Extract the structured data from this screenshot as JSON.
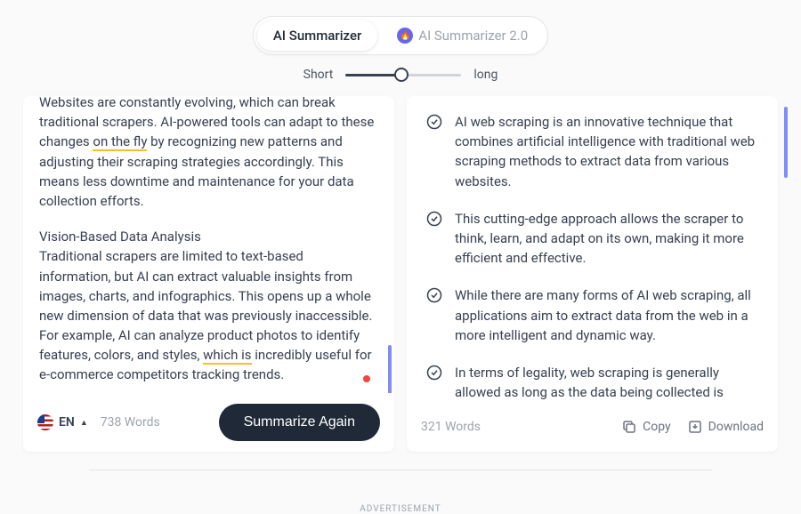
{
  "tabs": {
    "summarizer": "AI Summarizer",
    "summarizer2": "AI Summarizer 2.0"
  },
  "slider": {
    "short": "Short",
    "long": "long"
  },
  "input": {
    "para1_pre": "Websites are constantly evolving, which can break traditional scrapers. AI-powered tools can adapt to these changes ",
    "para1_underline": "on the fly",
    "para1_post": " by recognizing new patterns and adjusting their scraping strategies accordingly. This means less downtime and maintenance for your data collection efforts.",
    "subhead": "Vision-Based Data Analysis",
    "para2_pre": "Traditional scrapers are limited to text-based information, but AI can extract valuable insights from images, charts, and infographics. This opens up a whole new dimension of data that was previously inaccessible. For example, AI can analyze product photos to identify features, colors, and styles, ",
    "para2_underline": "which is",
    "para2_post": " incredibly useful for e-commerce competitors tracking trends."
  },
  "summary": [
    "AI web scraping is an innovative technique that combines artificial intelligence with traditional web scraping methods to extract data from various websites.",
    "This cutting-edge approach allows the scraper to think, learn, and adapt on its own, making it more efficient and effective.",
    "While there are many forms of AI web scraping, all applications aim to extract data from the web in a more intelligent and dynamic way.",
    "In terms of legality, web scraping is generally allowed as long as the data being collected is publicly available and does not violate any website's"
  ],
  "footer": {
    "lang": "EN",
    "input_words": "738 Words",
    "summarize": "Summarize Again",
    "output_words": "321 Words",
    "copy": "Copy",
    "download": "Download"
  },
  "ad": "ADVERTISEMENT"
}
